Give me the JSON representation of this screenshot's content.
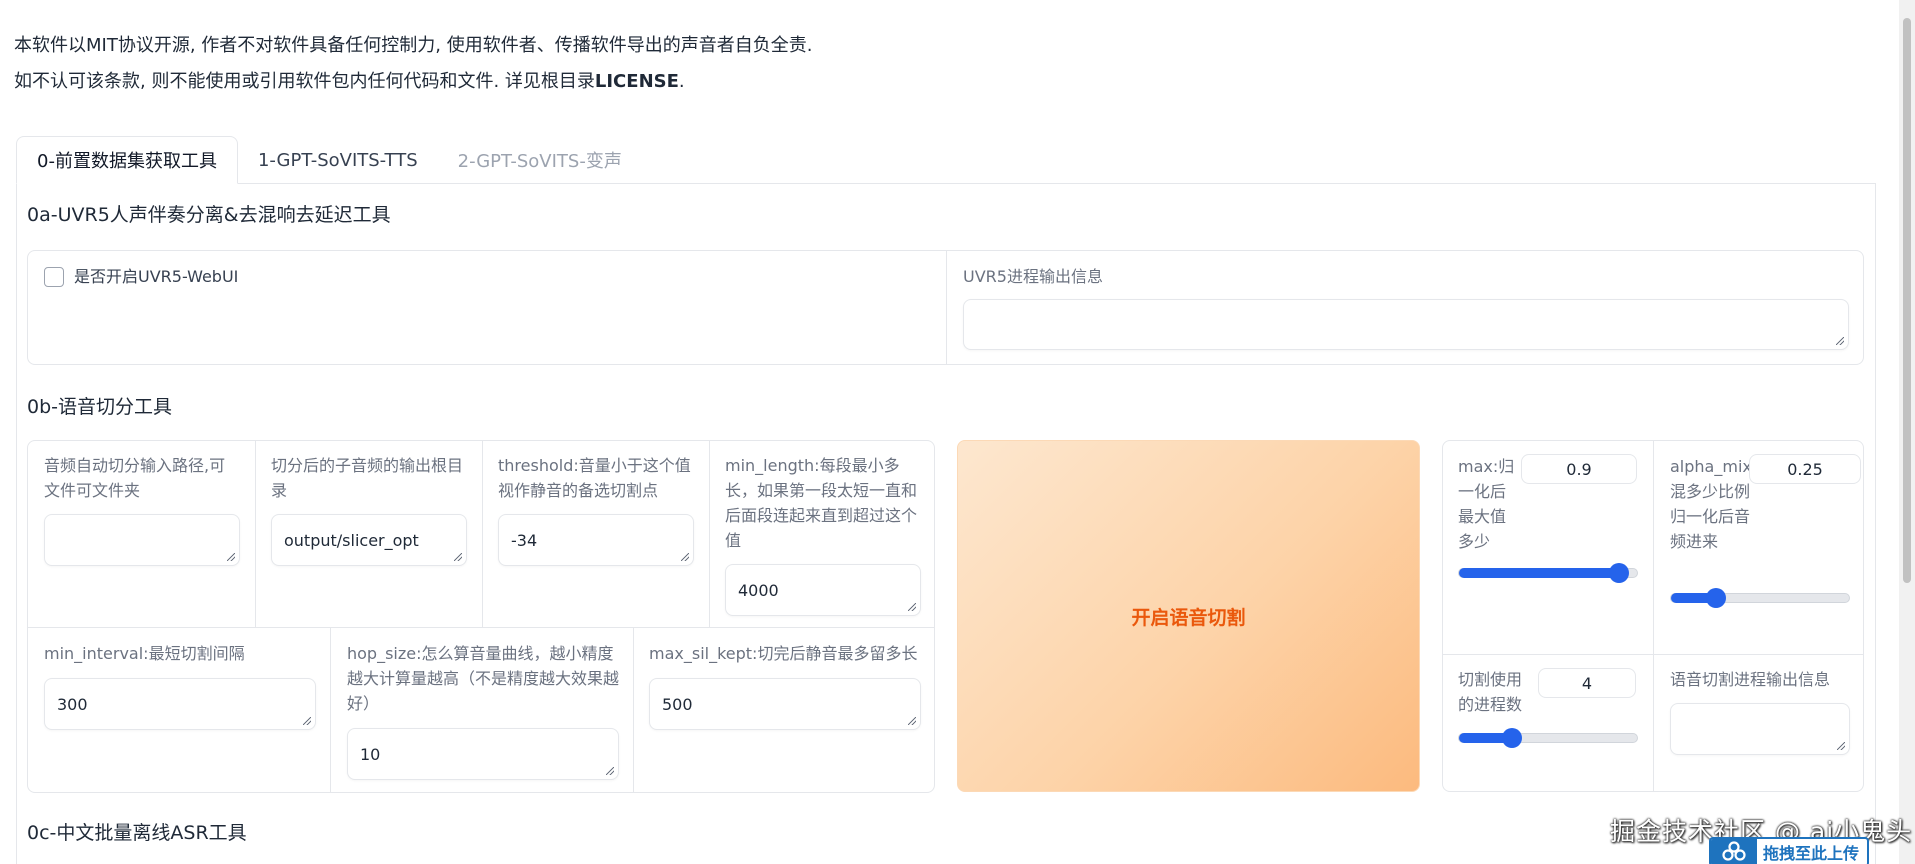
{
  "notice": {
    "line1": "本软件以MIT协议开源, 作者不对软件具备任何控制力, 使用软件者、传播软件导出的声音者自负全责.",
    "line2_prefix": "如不认可该条款, 则不能使用或引用软件包内任何代码和文件. 详见根目录",
    "line2_bold": "LICENSE",
    "line2_suffix": "."
  },
  "tabs": [
    {
      "label": "0-前置数据集获取工具",
      "state": "active"
    },
    {
      "label": "1-GPT-SoVITS-TTS",
      "state": "normal"
    },
    {
      "label": "2-GPT-SoVITS-变声",
      "state": "disabled"
    }
  ],
  "uvr5": {
    "title": "0a-UVR5人声伴奏分离&去混响去延迟工具",
    "checkbox_label": "是否开启UVR5-WebUI",
    "checked": false,
    "output_label": "UVR5进程输出信息",
    "output_value": ""
  },
  "slicer": {
    "title": "0b-语音切分工具",
    "input_path_label": "音频自动切分输入路径,可文件可文件夹",
    "input_path_value": "",
    "output_root_label": "切分后的子音频的输出根目录",
    "output_root_value": "output/slicer_opt",
    "threshold_label": "threshold:音量小于这个值视作静音的备选切割点",
    "threshold_value": "-34",
    "min_length_label": "min_length:每段最小多长，如果第一段太短一直和后面段连起来直到超过这个值",
    "min_length_value": "4000",
    "min_interval_label": "min_interval:最短切割间隔",
    "min_interval_value": "300",
    "hop_size_label": "hop_size:怎么算音量曲线，越小精度越大计算量越高（不是精度越大效果越好）",
    "hop_size_value": "10",
    "max_sil_kept_label": "max_sil_kept:切完后静音最多留多长",
    "max_sil_kept_value": "500",
    "start_button": "开启语音切割",
    "max_label": "max:归一化后最大值多少",
    "max_value": "0.9",
    "max_fraction": 0.9,
    "alpha_mix_label": "alpha_mix:混多少比例归一化后音频进来",
    "alpha_mix_value": "0.25",
    "alpha_mix_fraction": 0.25,
    "n_process_label": "切割使用的进程数",
    "n_process_value": "4",
    "n_process_fraction": 0.3,
    "output_info_label": "语音切割进程输出信息",
    "output_info_value": ""
  },
  "asr": {
    "title": "0c-中文批量离线ASR工具"
  },
  "watermark": "掘金技术社区 @ ai小鬼头",
  "upload_button": "拖拽至此上传",
  "colors": {
    "accent": "#2563eb",
    "button_text": "#ea580c",
    "button_gradient_start": "#fde7cf",
    "button_gradient_end": "#fcba7e",
    "upload_blue": "#1e73be"
  }
}
